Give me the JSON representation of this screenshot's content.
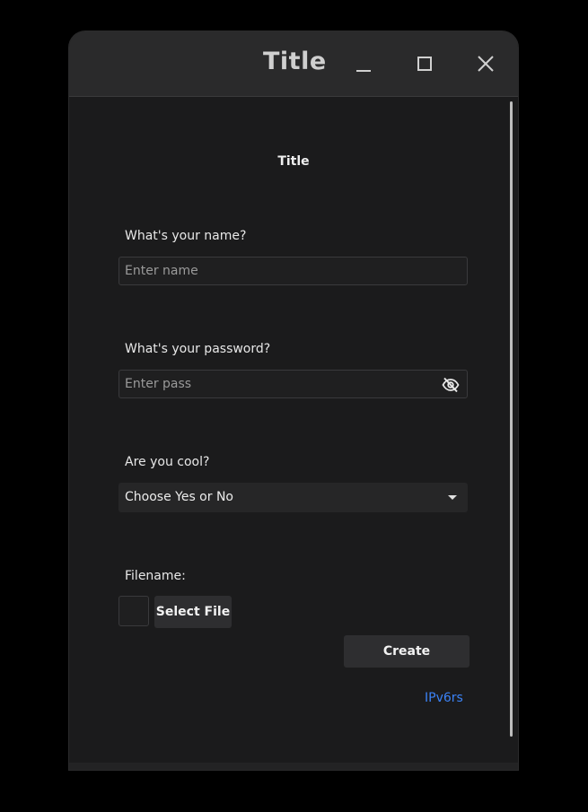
{
  "window": {
    "title": "Title"
  },
  "form": {
    "heading": "Title",
    "name_label": "What's your name?",
    "name_placeholder": "Enter name",
    "password_label": "What's your password?",
    "password_placeholder": "Enter pass",
    "cool_label": "Are you cool?",
    "cool_select_value": "Choose Yes or No",
    "filename_label": "Filename:",
    "select_file_label": "Select File",
    "create_label": "Create",
    "link_text": "IPv6rs"
  },
  "icons": {
    "minimize": "minimize-icon",
    "maximize": "maximize-icon",
    "close": "close-icon",
    "password_toggle": "eye-off-icon",
    "dropdown": "chevron-down-icon"
  },
  "colors": {
    "background": "#000000",
    "window": "#1b1b1c",
    "titlebar": "#2a2a2b",
    "link": "#3b82f6"
  }
}
